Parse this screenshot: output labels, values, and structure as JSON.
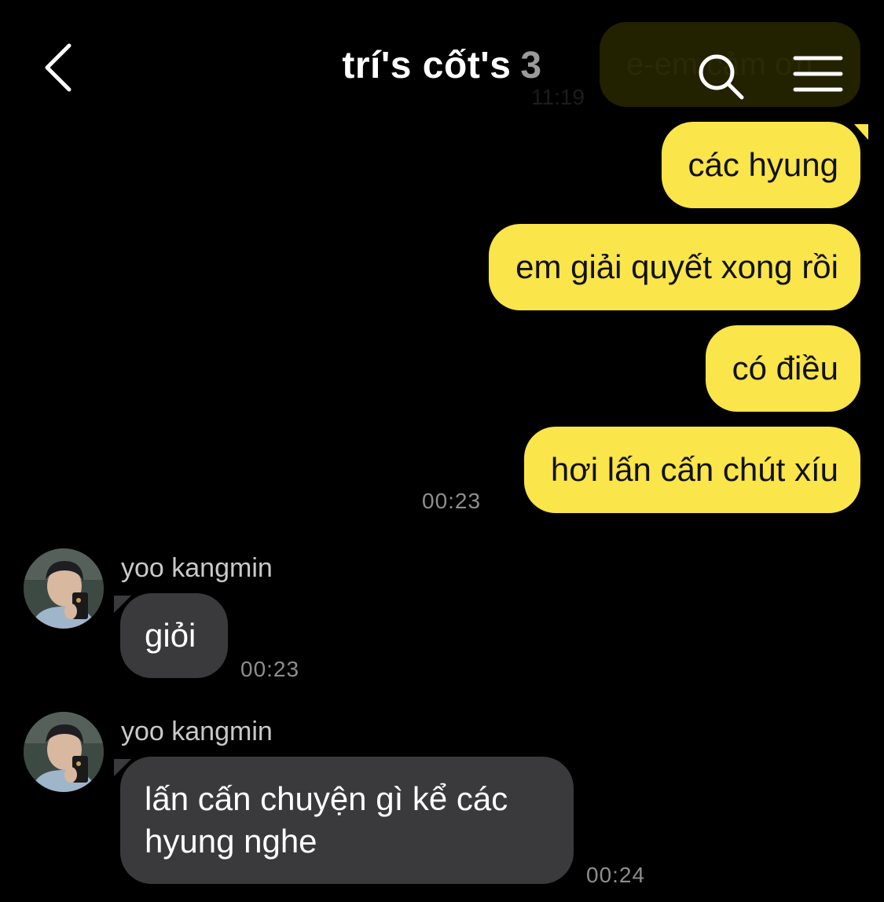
{
  "header": {
    "title": "trí's cốt's",
    "member_count": "3"
  },
  "previous": {
    "bubble_text": "e-em cảm ơn",
    "time": "11:19"
  },
  "outgoing": [
    {
      "text": "các hyung"
    },
    {
      "text": "em giải quyết xong rồi"
    },
    {
      "text": "có điều"
    },
    {
      "text": "hơi lấn cấn chút xíu"
    }
  ],
  "outgoing_time": "00:23",
  "incoming": [
    {
      "sender": "yoo kangmin",
      "text": "giỏi",
      "time": "00:23"
    },
    {
      "sender": "yoo kangmin",
      "text": "lấn cấn chuyện gì kể các hyung nghe",
      "time": "00:24"
    }
  ],
  "colors": {
    "background": "#000000",
    "outgoing_bubble": "#fae54a",
    "incoming_bubble": "#3a3a3c",
    "timestamp": "#8e8e8e"
  },
  "icons": [
    "back-chevron-icon",
    "search-icon",
    "menu-icon"
  ]
}
